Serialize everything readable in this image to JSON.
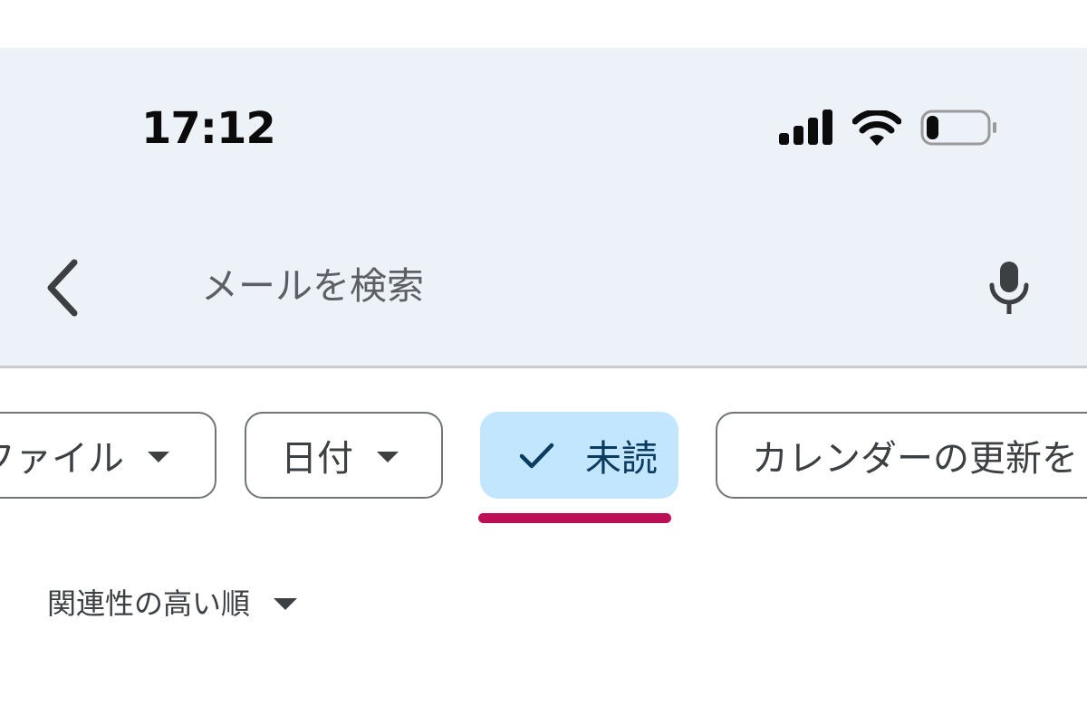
{
  "status_bar": {
    "time": "17:12",
    "signal_icon": "cellular-signal-icon",
    "wifi_icon": "wifi-icon",
    "battery_icon": "battery-icon",
    "battery_level": 0.2
  },
  "search_bar": {
    "back_icon": "chevron-left-icon",
    "placeholder": "メールを検索",
    "value": "",
    "mic_icon": "microphone-icon"
  },
  "filter_chips": [
    {
      "label": "ファイル",
      "has_dropdown": true,
      "selected": false
    },
    {
      "label": "日付",
      "has_dropdown": true,
      "selected": false
    },
    {
      "label": "未読",
      "has_dropdown": false,
      "selected": true
    },
    {
      "label": "カレンダーの更新を",
      "has_dropdown": false,
      "selected": false
    }
  ],
  "sort": {
    "label": "関連性の高い順"
  },
  "colors": {
    "app_bar_background": "#edf2f8",
    "selected_chip_background": "#c2e6fd",
    "selected_chip_text": "#0b3b5e",
    "selected_indicator": "#bd0f55",
    "chip_border": "#70757a"
  }
}
